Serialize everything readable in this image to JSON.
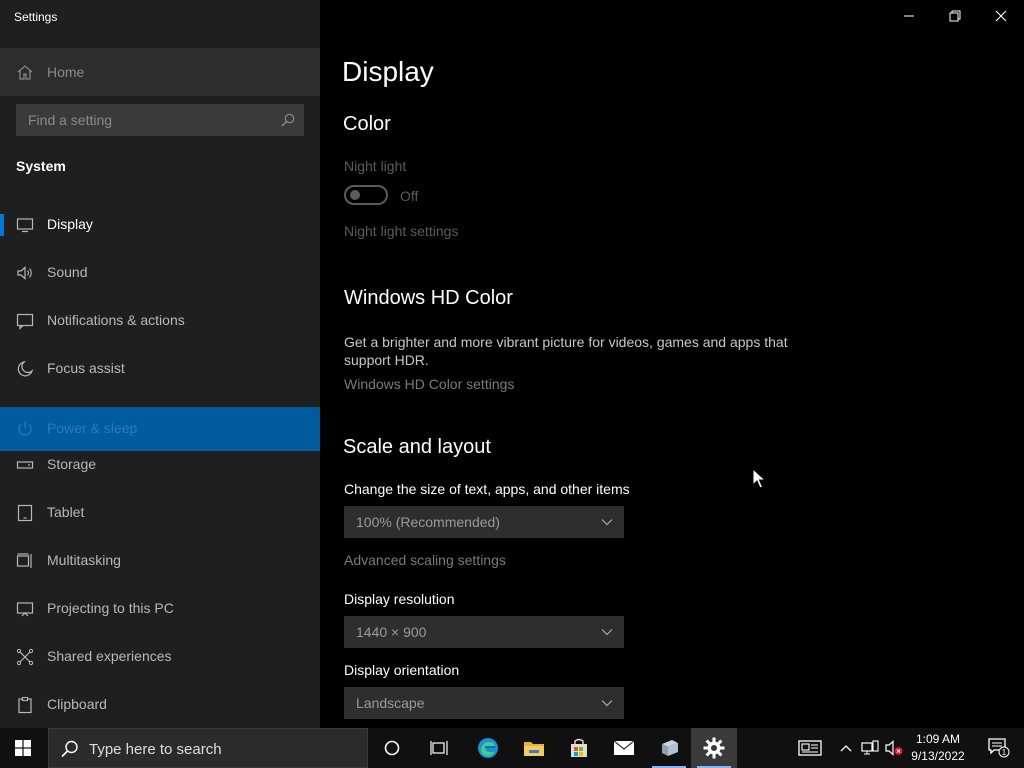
{
  "app": {
    "title": "Settings"
  },
  "sidebar": {
    "home_label": "Home",
    "search_placeholder": "Find a setting",
    "section": "System",
    "items": [
      {
        "label": "Display",
        "icon": "monitor-icon",
        "state": "selected"
      },
      {
        "label": "Sound",
        "icon": "speaker-icon",
        "state": "normal"
      },
      {
        "label": "Notifications & actions",
        "icon": "notification-icon",
        "state": "normal"
      },
      {
        "label": "Focus assist",
        "icon": "moon-icon",
        "state": "normal"
      },
      {
        "label": "Power & sleep",
        "icon": "power-icon",
        "state": "hover"
      },
      {
        "label": "Storage",
        "icon": "storage-icon",
        "state": "normal"
      },
      {
        "label": "Tablet",
        "icon": "tablet-icon",
        "state": "normal"
      },
      {
        "label": "Multitasking",
        "icon": "multitasking-icon",
        "state": "normal"
      },
      {
        "label": "Projecting to this PC",
        "icon": "projecting-icon",
        "state": "normal"
      },
      {
        "label": "Shared experiences",
        "icon": "shared-experiences-icon",
        "state": "normal"
      },
      {
        "label": "Clipboard",
        "icon": "clipboard-icon",
        "state": "normal"
      }
    ]
  },
  "content": {
    "page_title": "Display",
    "color": {
      "heading": "Color",
      "night_light_label": "Night light",
      "night_light_state": "Off",
      "night_light_settings": "Night light settings"
    },
    "hd_color": {
      "heading": "Windows HD Color",
      "description": "Get a brighter and more vibrant picture for videos, games and apps that support HDR.",
      "settings_link": "Windows HD Color settings"
    },
    "scale": {
      "heading": "Scale and layout",
      "size_label": "Change the size of text, apps, and other items",
      "size_value": "100% (Recommended)",
      "advanced_link": "Advanced scaling settings",
      "resolution_label": "Display resolution",
      "resolution_value": "1440 × 900",
      "orientation_label": "Display orientation",
      "orientation_value": "Landscape"
    }
  },
  "taskbar": {
    "search_text": "Type here to search",
    "time": "1:09 AM",
    "date": "9/13/2022",
    "notification_count": "1"
  },
  "colors": {
    "accent": "#0078d7",
    "sidebar_bg": "#1f1f1f",
    "hover_bg": "#005a9e"
  }
}
